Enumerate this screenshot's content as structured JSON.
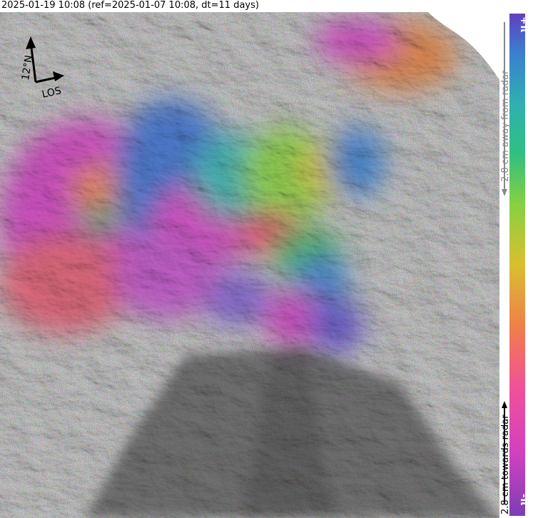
{
  "header": {
    "title": "2025-01-19 10:08 (ref=2025-01-07 10:08, dt=11 days)"
  },
  "map": {
    "north_arrow_label": "12°N",
    "los_label": "LOS"
  },
  "colorbar": {
    "top_label": "+π",
    "bottom_label": "-π",
    "away_label": "2.8 cm away from radar",
    "towards_label": "2.8 cm towards radar",
    "gradient_colors": [
      "#7b3fb4",
      "#d040c0",
      "#f0509a",
      "#f08048",
      "#d8c030",
      "#88d040",
      "#30c080",
      "#30b0b0",
      "#3a80d0",
      "#6040c0"
    ]
  }
}
